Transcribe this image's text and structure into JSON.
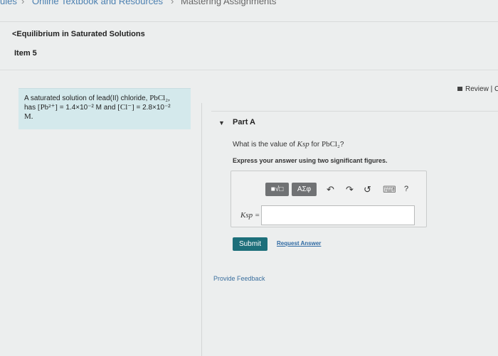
{
  "breadcrumb": {
    "item1": "ules",
    "item2": "Online Textbook and Resources",
    "item3": "Mastering Assignments",
    "sep": "›"
  },
  "nav": {
    "back_link": "<Equilibrium in Saturated Solutions",
    "item_title": "Item 5",
    "review": "Review | C"
  },
  "problem": {
    "line1_prefix": "A saturated solution of lead(II) chloride, ",
    "line1_formula": "PbCl₂,",
    "line2_prefix": "has ",
    "pb": "[Pb²⁺]",
    "line2_mid": " = 1.4×10⁻² M and ",
    "cl": "[Cl⁻]",
    "line2_end": " = 2.8×10⁻²",
    "line3": "M."
  },
  "part": {
    "label": "Part A",
    "question_prefix": "What is the value of ",
    "question_var": "Ksp",
    "question_mid": " for ",
    "question_formula": "PbCl₂",
    "question_end": "?",
    "instruction": "Express your answer using two significant figures."
  },
  "answer": {
    "ksp_label": "Ksp =",
    "input_value": "",
    "toolbar": {
      "templates": "■√□",
      "symbols": "ΑΣφ",
      "undo": "↶",
      "redo": "↷",
      "reset": "↺",
      "keyboard": "⌨",
      "help": "?"
    }
  },
  "actions": {
    "submit": "Submit",
    "request_answer": "Request Answer",
    "provide_feedback": "Provide Feedback"
  }
}
